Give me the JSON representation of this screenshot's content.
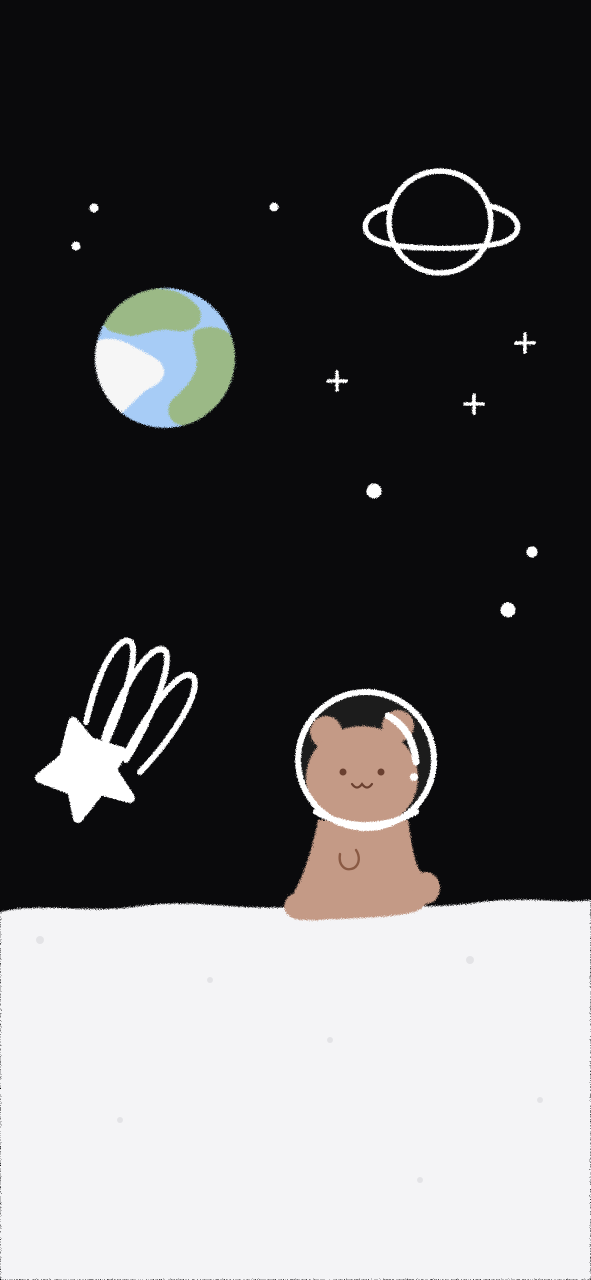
{
  "wallpaper": {
    "colors": {
      "space": "#0a0a0c",
      "ground": "#f4f4f6",
      "ground_shadow": "#dcdce0",
      "outline": "#ffffff",
      "earth_ocean": "#a7ccf6",
      "earth_land": "#9bb986",
      "earth_cloud": "#f6f6f6",
      "bear_fur": "#c49a86",
      "bear_face": "#6a4030",
      "helmet_inner": "#1a1a1a"
    },
    "icons": [
      "earth-icon",
      "ringed-planet-icon",
      "shooting-star-icon",
      "sparkle-icon",
      "dot-star-icon",
      "astronaut-bear-icon",
      "space-helmet-icon"
    ]
  }
}
